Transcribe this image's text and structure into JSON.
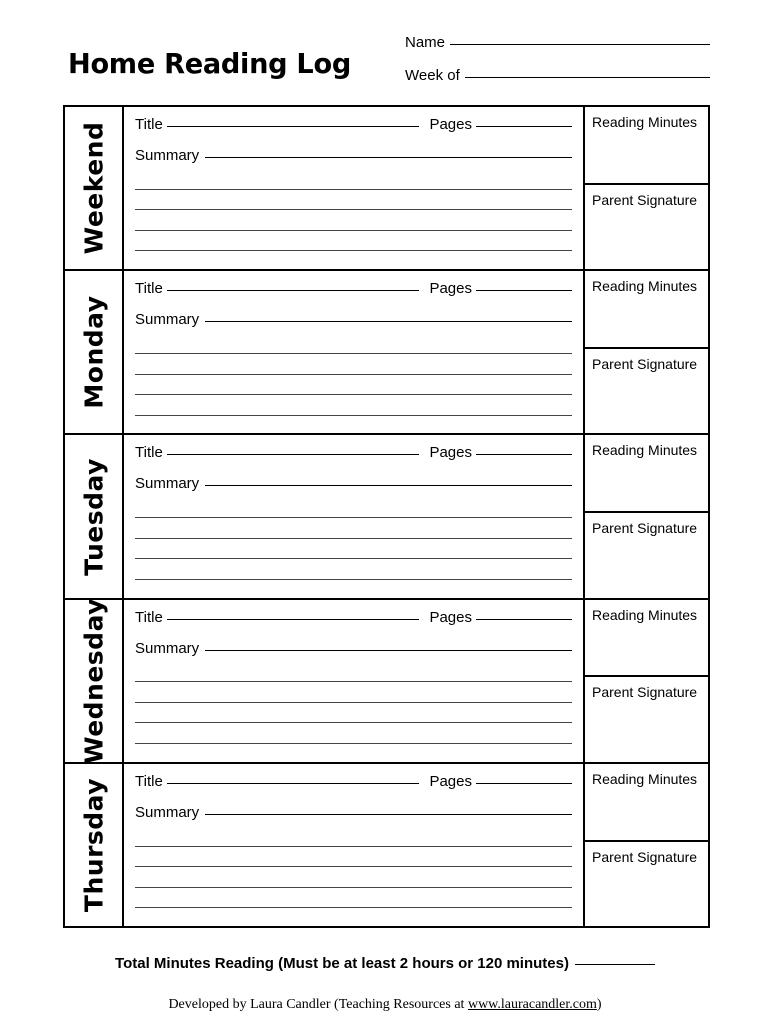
{
  "header": {
    "title": "Home Reading Log",
    "fields": [
      {
        "label": "Name"
      },
      {
        "label": "Week of"
      }
    ]
  },
  "table": {
    "entry_labels": {
      "title": "Title",
      "pages": "Pages",
      "summary": "Summary"
    },
    "meta_labels": {
      "minutes": "Reading Minutes",
      "signature": "Parent Signature"
    },
    "blank_rule_count": 4,
    "rows": [
      {
        "day": "Weekend"
      },
      {
        "day": "Monday"
      },
      {
        "day": "Tuesday"
      },
      {
        "day": "Wednesday"
      },
      {
        "day": "Thursday"
      }
    ]
  },
  "footer": {
    "total_label": "Total Minutes Reading (Must be at least 2 hours or 120 minutes)",
    "credit_prefix": "Developed by Laura Candler (Teaching Resources at ",
    "credit_url": "www.lauracandler.com",
    "credit_suffix": ")"
  }
}
